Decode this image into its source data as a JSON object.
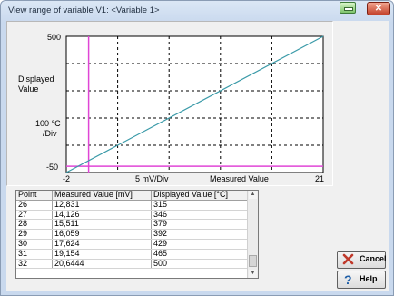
{
  "window": {
    "title": "View range of variable V1: <Variable 1>",
    "close_glyph": "✕"
  },
  "chart_data": {
    "type": "line",
    "x_axis": {
      "min_label": "-2",
      "max_label": "21",
      "div_label": "5 mV/Div",
      "label": "Measured Value"
    },
    "y_axis": {
      "max_label": "500",
      "min_label": "-50",
      "label_line1": "Displayed",
      "label_line2": "Value",
      "div_line1": "100 °C",
      "div_line2": "/Div"
    },
    "xlim": [
      -2,
      21
    ],
    "ylim": [
      -50,
      500
    ],
    "series": [
      {
        "x": [
          -2,
          21
        ],
        "y": [
          -50,
          500
        ],
        "color": "#3a9aa8"
      }
    ],
    "cursor": {
      "x": 0,
      "y": -25,
      "color": "#e046d6"
    },
    "grid": true
  },
  "table": {
    "columns": [
      "Point",
      "Measured Value [mV]",
      "Displayed Value [°C]"
    ],
    "rows": [
      [
        "26",
        "12,831",
        "315"
      ],
      [
        "27",
        "14,126",
        "346"
      ],
      [
        "28",
        "15,511",
        "379"
      ],
      [
        "29",
        "16,059",
        "392"
      ],
      [
        "30",
        "17,624",
        "429"
      ],
      [
        "31",
        "19,154",
        "465"
      ],
      [
        "32",
        "20,6444",
        "500"
      ]
    ],
    "scroll_fraction": 0.95
  },
  "buttons": {
    "cancel": "Cancel",
    "help": "Help"
  },
  "icons": {
    "cancel": "x-icon",
    "help": "question-icon"
  },
  "colors": {
    "line": "#3a9aa8",
    "cursor": "#e046d6",
    "cancel_icon": "#c0392b",
    "help_icon": "#1f5fa8"
  }
}
